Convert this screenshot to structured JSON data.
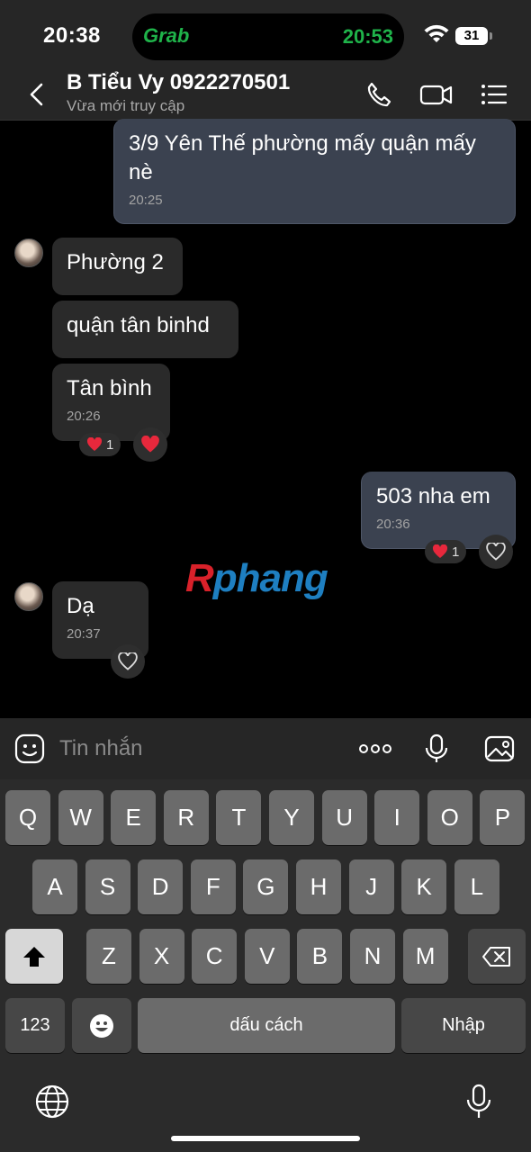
{
  "status_bar": {
    "time": "20:38",
    "island_app": "Grab",
    "island_time": "20:53",
    "battery": "31"
  },
  "header": {
    "contact_name": "B Tiểu Vy 0922270501",
    "contact_status": "Vừa mới truy cập"
  },
  "messages": [
    {
      "direction": "out",
      "text_line1": "3/9 Yên Thế phường mấy quận mấy",
      "text_line2": "nè",
      "time": "20:25"
    },
    {
      "direction": "in",
      "text": "Phường 2"
    },
    {
      "direction": "in",
      "text": "quận tân binhd"
    },
    {
      "direction": "in",
      "text": "Tân bình",
      "time": "20:26",
      "reaction_count": "1"
    },
    {
      "direction": "out",
      "text": "503 nha em",
      "time": "20:36",
      "reaction_count": "1"
    },
    {
      "direction": "in",
      "text": "Dạ",
      "time": "20:37"
    }
  ],
  "watermark": {
    "r": "R",
    "rest": "phang"
  },
  "input": {
    "placeholder": "Tin nhắn"
  },
  "keyboard": {
    "row1": [
      "Q",
      "W",
      "E",
      "R",
      "T",
      "Y",
      "U",
      "I",
      "O",
      "P"
    ],
    "row2": [
      "A",
      "S",
      "D",
      "F",
      "G",
      "H",
      "J",
      "K",
      "L"
    ],
    "row3": [
      "Z",
      "X",
      "C",
      "V",
      "B",
      "N",
      "M"
    ],
    "numbers_label": "123",
    "space_label": "dấu cách",
    "return_label": "Nhập"
  },
  "colors": {
    "outgoing_bubble": "#3b4250",
    "incoming_bubble": "#2a2a2a",
    "grab_green": "#1fb34a",
    "heart_red": "#e8283c"
  }
}
